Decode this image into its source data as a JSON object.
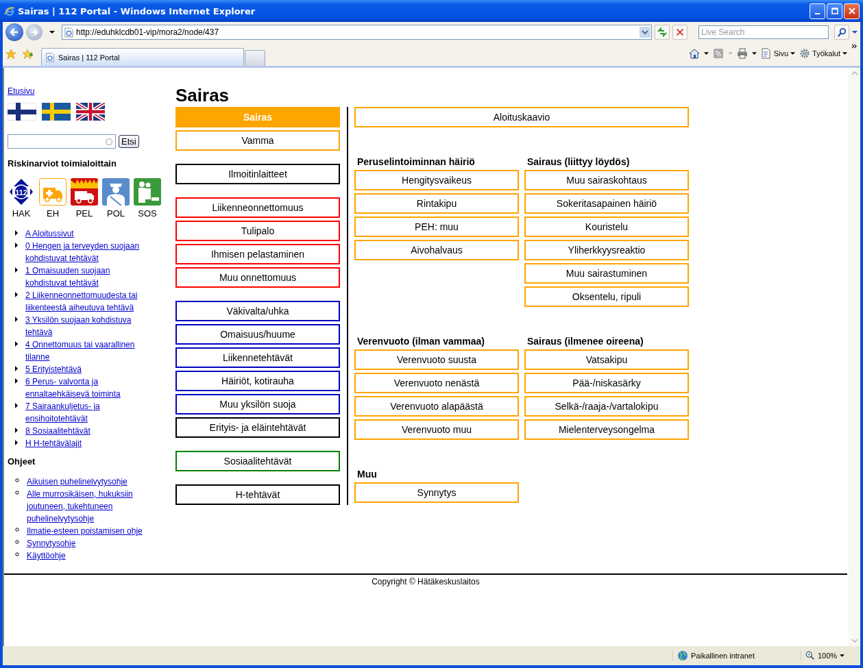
{
  "browser": {
    "title": "Sairas | 112 Portal - Windows Internet Explorer",
    "address": "http://eduhklcdb01-vip/mora2/node/437",
    "search_placeholder": "Live Search",
    "tab": "Sairas | 112 Portal",
    "toolbar": [
      "Sivu",
      "Työkalut"
    ],
    "status_zone": "Paikallinen intranet",
    "zoom": "100%"
  },
  "sidebar": {
    "home_link": "Etusivu",
    "search_button": "Etsi",
    "risk_heading": "Riskinarviot toimialoittain",
    "services": [
      {
        "label": "HAK",
        "kind": "hak",
        "icon_text": "112"
      },
      {
        "label": "EH",
        "kind": "ambulance"
      },
      {
        "label": "PEL",
        "kind": "fire"
      },
      {
        "label": "POL",
        "kind": "police"
      },
      {
        "label": "SOS",
        "kind": "social"
      }
    ],
    "task_links": [
      "A Aloitussivut",
      "0 Hengen ja terveyden suojaan kohdistuvat tehtävät",
      "1 Omaisuuden suojaan kohdistuvat tehtävät",
      "2 Liikenneonnettomuudesta tai liikenteestä aiheutuva tehtävä",
      "3 Yksilön suojaan kohdistuva tehtävä",
      "4 Onnettomuus tai vaarallinen tilanne",
      "5 Erityistehtävä",
      "6 Perus- valvonta ja ennaltaehkäisevä toiminta",
      "7 Sairaankuljetus- ja ensihoitotehtävät",
      "8 Sosiaalitehtävät",
      "H H-tehtävälajit"
    ],
    "help_heading": "Ohjeet",
    "help_links": [
      "Aikuisen puhelinelvytysohje",
      "Alle murrosikäisen, hukuksiin joutuneen, tukehtuneen puhelinelvytysohje",
      "Ilmatie-esteen poistamisen ohje",
      "Synnytysohje",
      "Käyttöohje"
    ]
  },
  "page": {
    "title": "Sairas",
    "category_groups": [
      [
        {
          "label": "Sairas",
          "color": "#ffa500",
          "selected": true
        },
        {
          "label": "Vamma",
          "color": "#ffa500",
          "selected": false
        }
      ],
      [
        {
          "label": "Ilmoitinlaitteet",
          "color": "#000000",
          "selected": false
        }
      ],
      [
        {
          "label": "Liikenneonnettomuus",
          "color": "#ff0000",
          "selected": false
        },
        {
          "label": "Tulipalo",
          "color": "#ff0000",
          "selected": false
        },
        {
          "label": "Ihmisen pelastaminen",
          "color": "#ff0000",
          "selected": false
        },
        {
          "label": "Muu onnettomuus",
          "color": "#ff0000",
          "selected": false
        }
      ],
      [
        {
          "label": "Väkivalta/uhka",
          "color": "#0000c0",
          "selected": false
        },
        {
          "label": "Omaisuus/huume",
          "color": "#0000c0",
          "selected": false
        },
        {
          "label": "Liikennetehtävät",
          "color": "#0000c0",
          "selected": false
        },
        {
          "label": "Häiriöt, kotirauha",
          "color": "#0000c0",
          "selected": false
        },
        {
          "label": "Muu yksilön suoja",
          "color": "#0000c0",
          "selected": false
        },
        {
          "label": "Erityis- ja eläintehtävät",
          "color": "#000000",
          "selected": false
        }
      ],
      [
        {
          "label": "Sosiaalitehtävät",
          "color": "#008000",
          "selected": false
        }
      ],
      [
        {
          "label": "H-tehtävät",
          "color": "#000000",
          "selected": false
        }
      ]
    ],
    "start_button": "Aloituskaavio",
    "section_rows": [
      [
        {
          "heading": "Peruselintoiminnan häiriö",
          "items": [
            "Hengitysvaikeus",
            "Rintakipu",
            "PEH: muu",
            "Aivohalvaus"
          ]
        },
        {
          "heading": "Sairaus (liittyy löydös)",
          "items": [
            "Muu sairaskohtaus",
            "Sokeritasapainen häiriö",
            "Kouristelu",
            "Yliherkkyysreaktio",
            "Muu sairastuminen",
            "Oksentelu, ripuli"
          ]
        }
      ],
      [
        {
          "heading": "Verenvuoto (ilman vammaa)",
          "items": [
            "Verenvuoto suusta",
            "Verenvuoto nenästä",
            "Verenvuoto alapäästä",
            "Verenvuoto muu"
          ]
        },
        {
          "heading": "Sairaus (ilmenee oireena)",
          "items": [
            "Vatsakipu",
            "Pää-/niskasärky",
            "Selkä-/raaja-/vartalokipu",
            "Mielenterveysongelma"
          ]
        }
      ],
      [
        {
          "heading": "Muu",
          "items": [
            "Synnytys"
          ]
        }
      ]
    ]
  },
  "footer": "Copyright © Hätäkeskuslaitos"
}
